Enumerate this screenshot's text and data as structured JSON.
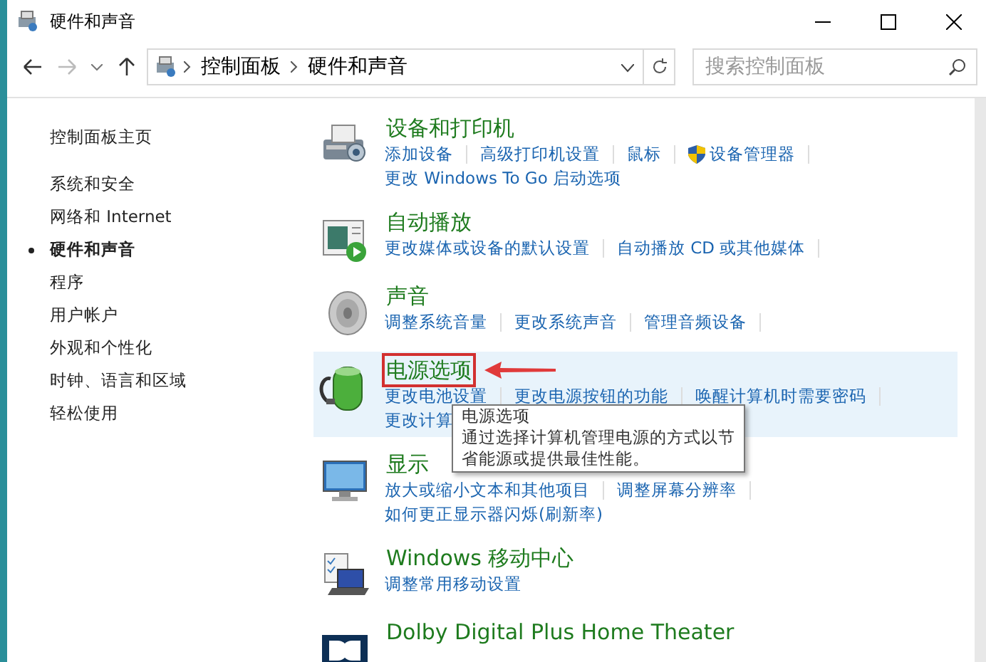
{
  "window": {
    "title": "硬件和声音"
  },
  "address_bar": {
    "crumbs": [
      "控制面板",
      "硬件和声音"
    ]
  },
  "search": {
    "placeholder": "搜索控制面板"
  },
  "sidebar": {
    "items": [
      {
        "label": "控制面板主页",
        "selected": false
      },
      {
        "label": "系统和安全",
        "selected": false
      },
      {
        "label": "网络和 Internet",
        "selected": false
      },
      {
        "label": "硬件和声音",
        "selected": true
      },
      {
        "label": "程序",
        "selected": false
      },
      {
        "label": "用户帐户",
        "selected": false
      },
      {
        "label": "外观和个性化",
        "selected": false
      },
      {
        "label": "时钟、语言和区域",
        "selected": false
      },
      {
        "label": "轻松使用",
        "selected": false
      }
    ]
  },
  "sections": [
    {
      "kind": "printer",
      "title": "设备和打印机",
      "hovered": false,
      "highlighted": false,
      "link_lines": [
        [
          {
            "label": "添加设备"
          },
          {
            "label": "高级打印机设置"
          },
          {
            "label": "鼠标"
          },
          {
            "label": "设备管理器",
            "shield": true
          }
        ],
        [
          {
            "label": "更改 Windows To Go 启动选项"
          }
        ]
      ]
    },
    {
      "kind": "autoplay",
      "title": "自动播放",
      "hovered": false,
      "highlighted": false,
      "link_lines": [
        [
          {
            "label": "更改媒体或设备的默认设置"
          },
          {
            "label": "自动播放 CD 或其他媒体"
          }
        ]
      ]
    },
    {
      "kind": "sound",
      "title": "声音",
      "hovered": false,
      "highlighted": false,
      "link_lines": [
        [
          {
            "label": "调整系统音量"
          },
          {
            "label": "更改系统声音"
          },
          {
            "label": "管理音频设备"
          }
        ]
      ]
    },
    {
      "kind": "power",
      "title": "电源选项",
      "hovered": true,
      "highlighted": true,
      "link_lines": [
        [
          {
            "label": "更改电池设置"
          },
          {
            "label": "更改电源按钮的功能"
          },
          {
            "label": "唤醒计算机时需要密码"
          }
        ],
        [
          {
            "label": "更改计算"
          }
        ]
      ]
    },
    {
      "kind": "display",
      "title": "显示",
      "hovered": false,
      "highlighted": false,
      "link_lines": [
        [
          {
            "label": "放大或缩小文本和其他项目"
          },
          {
            "label": "调整屏幕分辨率"
          }
        ],
        [
          {
            "label": "如何更正显示器闪烁(刷新率)"
          }
        ]
      ]
    },
    {
      "kind": "mobility",
      "title": "Windows 移动中心",
      "hovered": false,
      "highlighted": false,
      "link_lines": [
        [
          {
            "label": "调整常用移动设置"
          }
        ]
      ]
    },
    {
      "kind": "dolby",
      "title": "Dolby Digital Plus Home Theater",
      "hovered": false,
      "highlighted": false
    }
  ],
  "tooltip": {
    "title": "电源选项",
    "text": "通过选择计算机管理电源的方式以节省能源或提供最佳性能。"
  }
}
